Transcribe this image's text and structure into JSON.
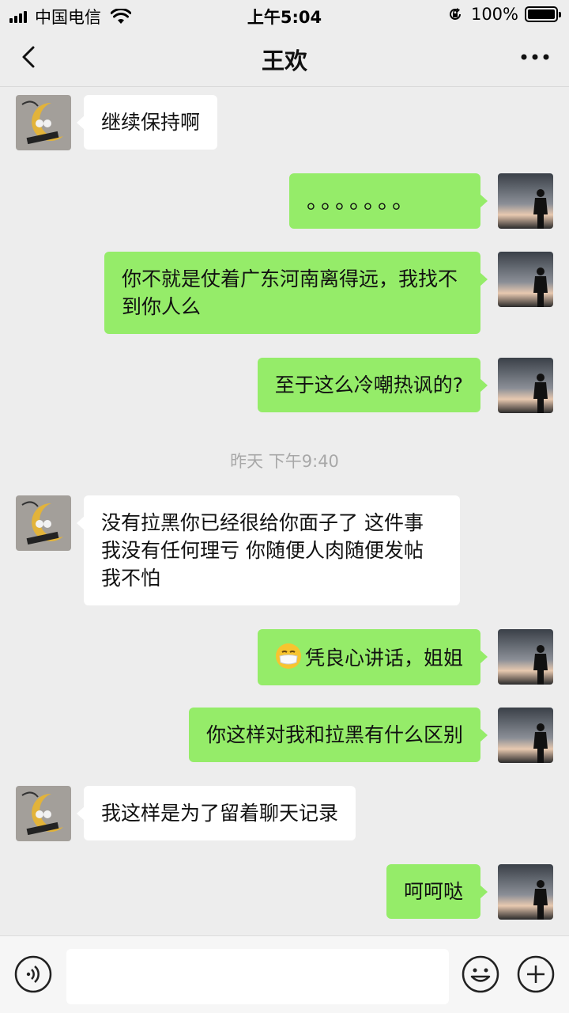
{
  "status_bar": {
    "carrier": "中国电信",
    "time": "上午5:04",
    "battery_text": "100%",
    "icons": [
      "signal-icon",
      "wifi-icon",
      "orientation-lock-icon",
      "battery-icon"
    ]
  },
  "nav": {
    "title": "王欢",
    "back_icon": "chevron-left-icon",
    "more_icon": "more-dots-icon"
  },
  "messages": [
    {
      "side": "left",
      "text": "继续保持啊"
    },
    {
      "side": "right",
      "text": "。。。。。。。"
    },
    {
      "side": "right",
      "text": "你不就是仗着广东河南离得远，我找不到你人么"
    },
    {
      "side": "right",
      "text": "至于这么冷嘲热讽的?"
    },
    {
      "side": "left",
      "text": "没有拉黑你已经很给你面子了 这件事我没有任何理亏 你随便人肉随便发帖 我不怕"
    },
    {
      "side": "right",
      "text": "凭良心讲话，姐姐",
      "emoji": "mask-face-emoji"
    },
    {
      "side": "right",
      "text": "你这样对我和拉黑有什么区别"
    },
    {
      "side": "left",
      "text": "我这样是为了留着聊天记录"
    },
    {
      "side": "right",
      "text": "呵呵哒"
    }
  ],
  "timestamp": "昨天 下午9:40",
  "input_bar": {
    "placeholder": "",
    "icons": [
      "voice-icon",
      "emoji-icon",
      "plus-icon"
    ]
  },
  "colors": {
    "background": "#ededed",
    "sent_bubble": "#95ec69",
    "received_bubble": "#ffffff",
    "timestamp_text": "#a8a8a8"
  }
}
